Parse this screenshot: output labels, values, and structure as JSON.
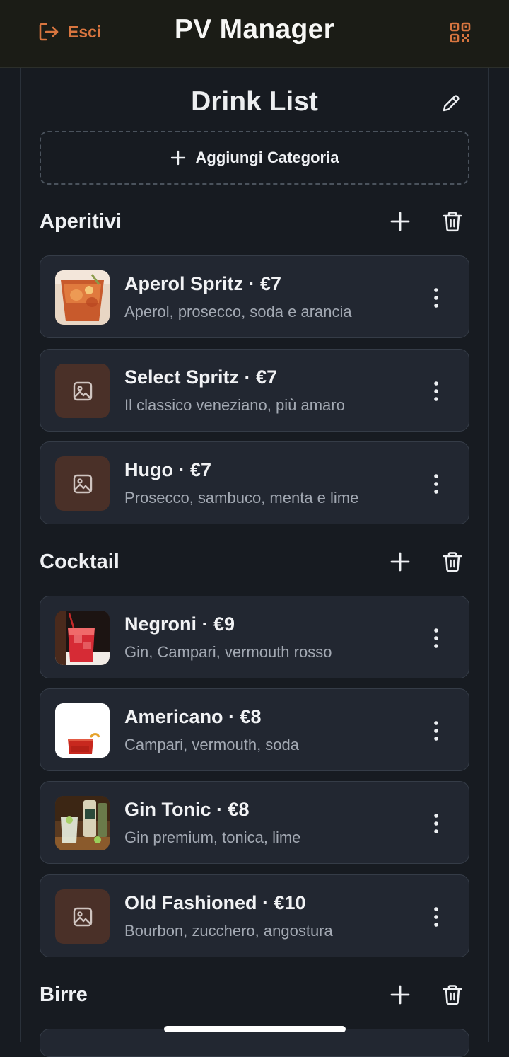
{
  "header": {
    "logout_label": "Esci",
    "title": "PV Manager",
    "accent_color": "#d8753f"
  },
  "page": {
    "title": "Drink List",
    "add_category_label": "Aggiungi Categoria"
  },
  "categories": [
    {
      "name": "Aperitivi",
      "items": [
        {
          "title": "Aperol Spritz · €7",
          "desc": "Aperol, prosecco, soda e arancia",
          "image": "aperol-photo"
        },
        {
          "title": "Select Spritz · €7",
          "desc": "Il classico veneziano, più amaro",
          "image": "placeholder"
        },
        {
          "title": "Hugo · €7",
          "desc": "Prosecco, sambuco, menta e lime",
          "image": "placeholder"
        }
      ]
    },
    {
      "name": "Cocktail",
      "items": [
        {
          "title": "Negroni · €9",
          "desc": "Gin, Campari, vermouth rosso",
          "image": "negroni-photo"
        },
        {
          "title": "Americano · €8",
          "desc": "Campari, vermouth, soda",
          "image": "americano-photo"
        },
        {
          "title": "Gin Tonic · €8",
          "desc": "Gin premium, tonica, lime",
          "image": "gintonic-photo"
        },
        {
          "title": "Old Fashioned · €10",
          "desc": "Bourbon, zucchero, angostura",
          "image": "placeholder"
        }
      ]
    },
    {
      "name": "Birre",
      "items": []
    }
  ]
}
